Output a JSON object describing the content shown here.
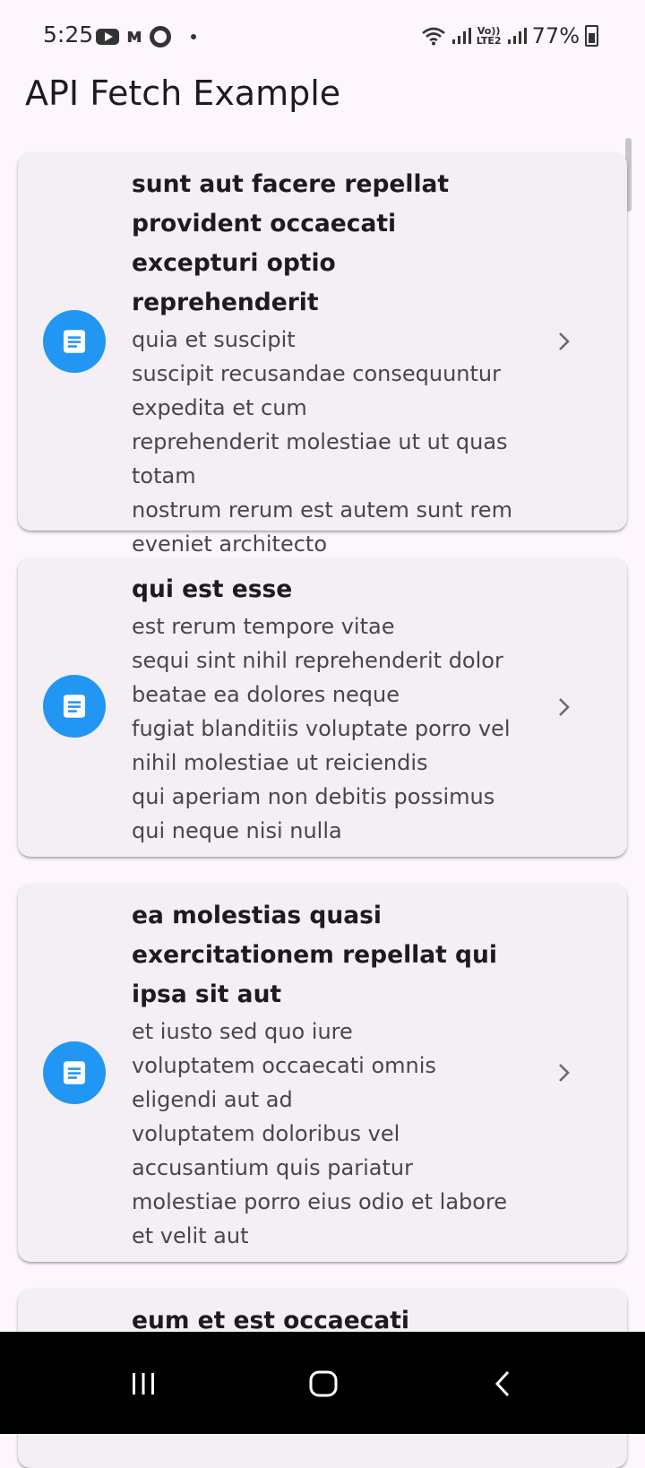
{
  "status_bar": {
    "time": "5:25",
    "battery": "77%",
    "network_label": "Vo)) LTE2",
    "icons": [
      "youtube-icon",
      "m-icon",
      "ring-icon",
      "dot-icon",
      "wifi-icon",
      "signal-icon",
      "battery-icon"
    ]
  },
  "app_bar": {
    "title": "API Fetch Example"
  },
  "colors": {
    "accent": "#2196f3",
    "card_bg": "#f4eff4",
    "page_bg": "#fdf7fd"
  },
  "posts": [
    {
      "title": "sunt aut facere repellat provident occaecati excepturi optio reprehenderit",
      "body": "quia et suscipit\nsuscipit recusandae consequuntur expedita et cum\nreprehenderit molestiae ut ut quas totam\nnostrum rerum est autem sunt rem eveniet architecto"
    },
    {
      "title": "qui est esse",
      "body": "est rerum tempore vitae\nsequi sint nihil reprehenderit dolor beatae ea dolores neque\nfugiat blanditiis voluptate porro vel nihil molestiae ut reiciendis\nqui aperiam non debitis possimus qui neque nisi nulla"
    },
    {
      "title": "ea molestias quasi exercitationem repellat qui ipsa sit aut",
      "body": "et iusto sed quo iure\nvoluptatem occaecati omnis eligendi aut ad\nvoluptatem doloribus vel accusantium quis pariatur\nmolestiae porro eius odio et labore et velit aut"
    },
    {
      "title": "eum et est occaecati",
      "body": ""
    }
  ]
}
